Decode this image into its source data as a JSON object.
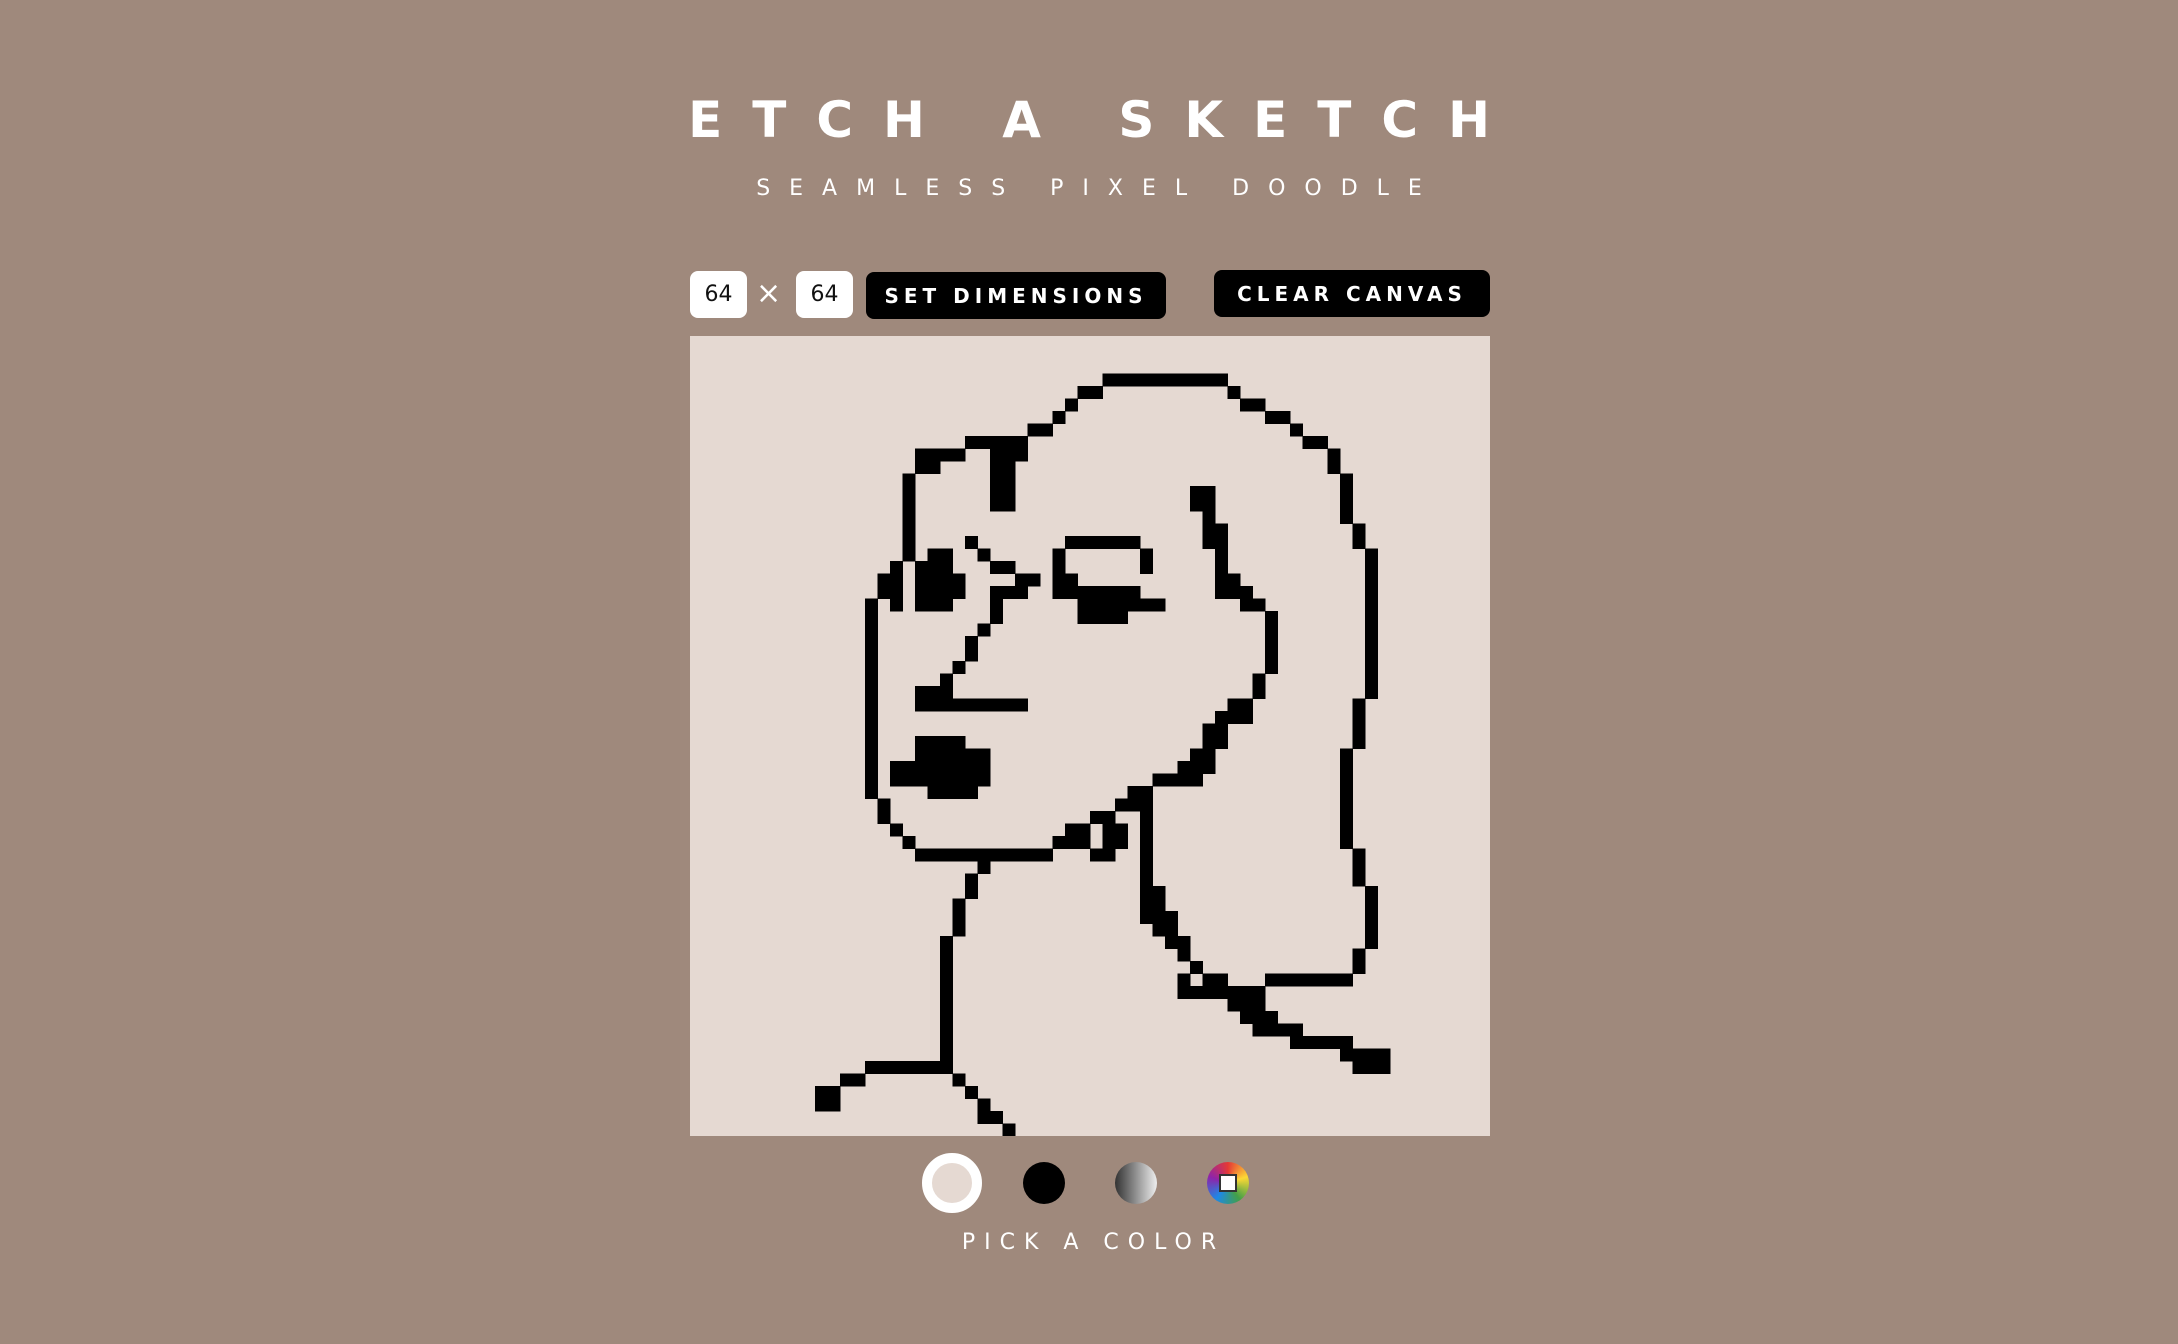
{
  "header": {
    "title": "ETCH A SKETCH",
    "subtitle": "SEAMLESS PIXEL DOODLE"
  },
  "controls": {
    "width_value": "64",
    "height_value": "64",
    "times_symbol": "×",
    "set_dimensions_label": "SET DIMENSIONS",
    "clear_canvas_label": "CLEAR CANVAS"
  },
  "canvas": {
    "grid_size": 64,
    "background_color": "#e5d9d2",
    "ink_color": "#000000"
  },
  "palette": {
    "label": "PICK A COLOR",
    "swatches": [
      {
        "name": "eraser",
        "color": "#e5d9d2",
        "selected": true
      },
      {
        "name": "black",
        "color": "#000000",
        "selected": false
      },
      {
        "name": "gradient-gray",
        "color": "#888888",
        "selected": false
      },
      {
        "name": "rainbow",
        "color": "multicolor",
        "selected": false
      }
    ]
  },
  "colors": {
    "page_background": "#9f897c",
    "button_background": "#000000",
    "text_color": "#ffffff"
  }
}
